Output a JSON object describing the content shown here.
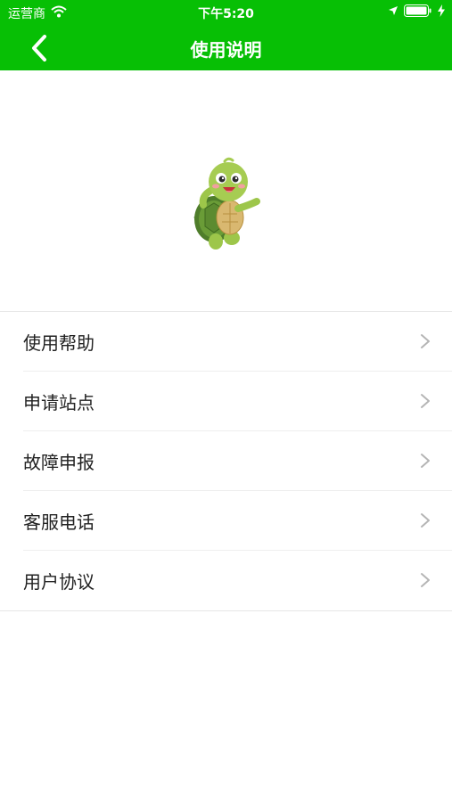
{
  "status_bar": {
    "carrier": "运营商",
    "time": "下午5:20",
    "icons": [
      "wifi-icon",
      "location-icon",
      "battery-icon",
      "charging-icon"
    ]
  },
  "nav": {
    "title": "使用说明",
    "back_icon": "chevron-left-icon"
  },
  "hero": {
    "image": "turtle-mascot"
  },
  "menu": {
    "items": [
      {
        "label": "使用帮助"
      },
      {
        "label": "申请站点"
      },
      {
        "label": "故障申报"
      },
      {
        "label": "客服电话"
      },
      {
        "label": "用户协议"
      }
    ],
    "chevron_icon": "chevron-right-icon"
  },
  "colors": {
    "brand_green": "#07bf05",
    "text": "#222222",
    "chevron": "#b5b5b5",
    "divider": "#eeeeee"
  }
}
